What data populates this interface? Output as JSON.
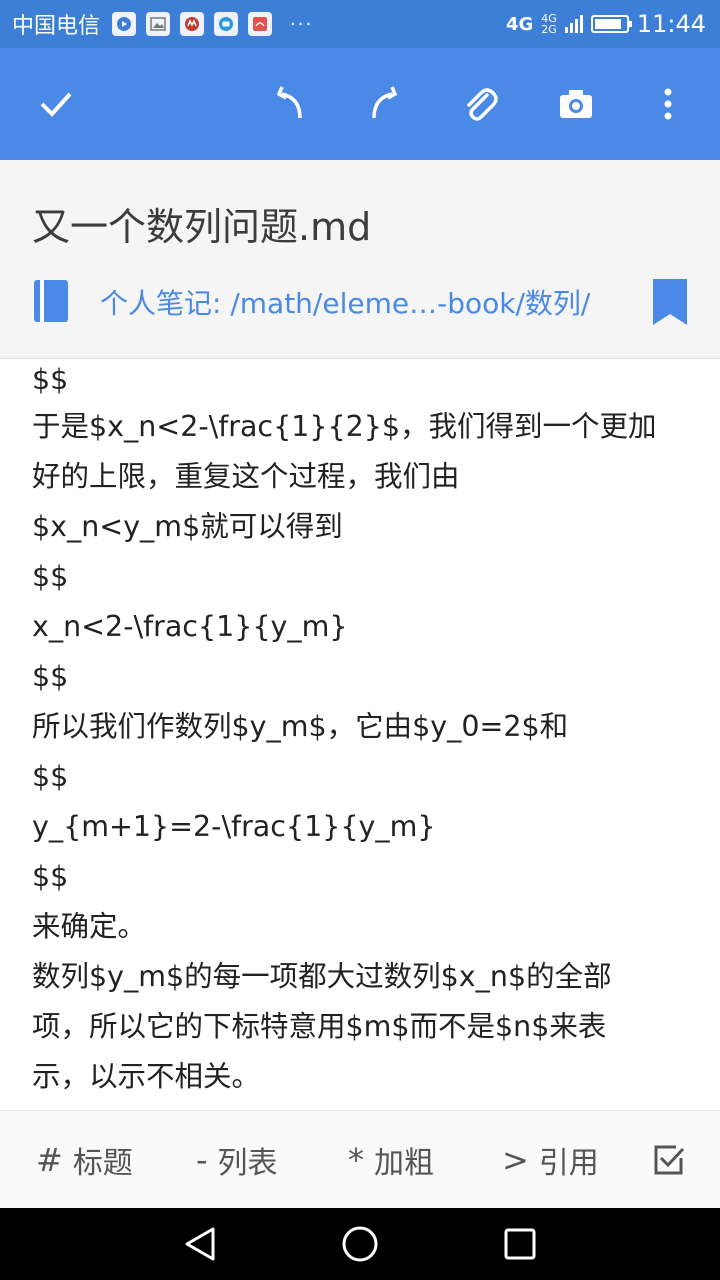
{
  "status_bar": {
    "carrier": "中国电信",
    "notification_icons": [
      "video-app-icon",
      "gallery-icon",
      "app-icon",
      "message-icon",
      "weather-icon"
    ],
    "more": "···",
    "network_primary": "4G",
    "network_secondary": [
      "4G",
      "2G"
    ],
    "time": "11:44"
  },
  "toolbar": {
    "color": "#4a89e6",
    "icons": [
      "check-icon",
      "undo-icon",
      "redo-icon",
      "attach-icon",
      "camera-icon",
      "more-vert-icon"
    ]
  },
  "note": {
    "title": "又一个数列问题.md",
    "notebook_path": "个人笔记: /math/eleme…-book/数列/"
  },
  "content_lines": [
    "$$",
    "于是$x_n<2-\\frac{1}{2}$，我们得到一个更加",
    "好的上限，重复这个过程，我们由",
    "$x_n<y_m$就可以得到",
    "$$",
    "x_n<2-\\frac{1}{y_m}",
    "$$",
    "所以我们作数列$y_m$，它由$y_0=2$和",
    "$$",
    "y_{m+1}=2-\\frac{1}{y_m}",
    "$$",
    "来确定。",
    "数列$y_m$的每一项都大过数列$x_n$的全部",
    "项，所以它的下标特意用$m$而不是$n$来表",
    "示，以示不相关。"
  ],
  "format_bar": {
    "heading": {
      "symbol": "#",
      "label": "标题"
    },
    "list": {
      "symbol": "-",
      "label": "列表"
    },
    "bold": {
      "symbol": "*",
      "label": "加粗"
    },
    "quote": {
      "symbol": ">",
      "label": "引用"
    },
    "checkbox_icon": "checkbox-icon"
  },
  "nav_bar": {
    "icons": [
      "back-icon",
      "home-icon",
      "recents-icon"
    ]
  }
}
